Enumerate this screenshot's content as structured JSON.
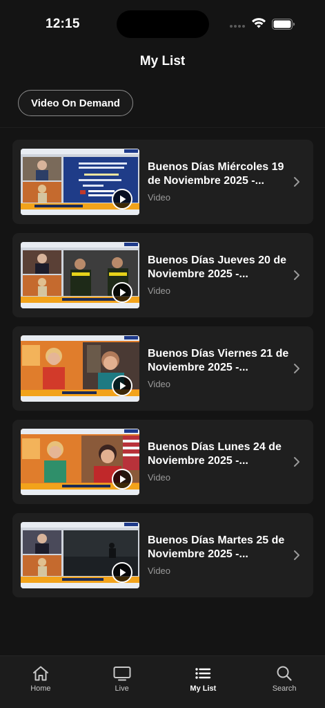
{
  "status_bar": {
    "time": "12:15"
  },
  "header": {
    "title": "My List"
  },
  "filter": {
    "label": "Video On Demand"
  },
  "items": [
    {
      "title": "Buenos Días Miércoles 19 de Noviembre 2025 -...",
      "type": "Video",
      "thumb_caption": "MIÉRCOLES DE INMIGRACIÓN"
    },
    {
      "title": "Buenos Días Jueves 20 de Noviembre 2025 -...",
      "type": "Video",
      "thumb_caption": "PANORAMA POLÍTICO EN VENEZUELA"
    },
    {
      "title": "Buenos Días Viernes 21 de Noviembre 2025 -...",
      "type": "Video",
      "thumb_caption": "MISS UNIVERSO 2025"
    },
    {
      "title": "Buenos Días Lunes 24 de Noviembre 2025 -...",
      "type": "Video",
      "thumb_caption": "PERSPECTIVAS DE GABY PÉREZ"
    },
    {
      "title": "Buenos Días Martes 25 de Noviembre 2025 -...",
      "type": "Video",
      "thumb_caption": "QUÉ PASA EN VENEZUELA"
    }
  ],
  "tabs": [
    {
      "label": "Home",
      "icon": "home-icon"
    },
    {
      "label": "Live",
      "icon": "tv-icon"
    },
    {
      "label": "My List",
      "icon": "list-icon",
      "active": true
    },
    {
      "label": "Search",
      "icon": "search-icon"
    }
  ],
  "colors": {
    "background": "#141414",
    "card": "#1f1f1f",
    "tabbar": "#1c1c1c",
    "secondary_text": "#9a9a9a"
  }
}
